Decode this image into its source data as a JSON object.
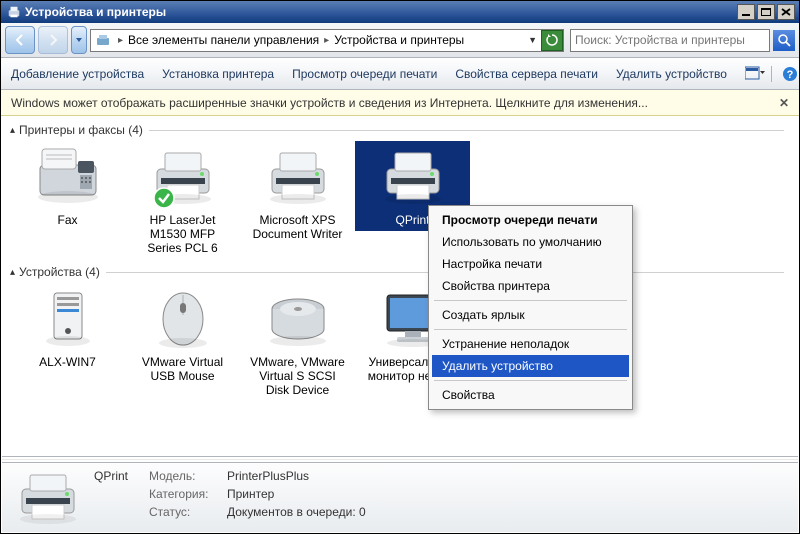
{
  "window": {
    "title": "Устройства и принтеры"
  },
  "nav": {
    "crumb1": "Все элементы панели управления",
    "crumb2": "Устройства и принтеры"
  },
  "search": {
    "placeholder": "Поиск: Устройства и принтеры"
  },
  "toolbar": {
    "add_device": "Добавление устройства",
    "add_printer": "Установка принтера",
    "view_queue": "Просмотр очереди печати",
    "server_props": "Свойства сервера печати",
    "delete_device": "Удалить устройство"
  },
  "infobar": {
    "text": "Windows может отображать расширенные значки устройств и сведения из Интернета.   Щелкните для изменения..."
  },
  "sections": {
    "printers": {
      "label": "Принтеры и факсы (4)"
    },
    "devices": {
      "label": "Устройства (4)"
    }
  },
  "printers": [
    {
      "label": "Fax"
    },
    {
      "label": "HP LaserJet M1530 MFP Series PCL 6"
    },
    {
      "label": "Microsoft XPS Document Writer"
    },
    {
      "label": "QPrint"
    }
  ],
  "devices": [
    {
      "label": "ALX-WIN7"
    },
    {
      "label": "VMware Virtual USB Mouse"
    },
    {
      "label": "VMware, VMware Virtual S SCSI Disk Device"
    },
    {
      "label": "Универсальный монитор не PnP"
    }
  ],
  "context_menu": {
    "open_queue": "Просмотр очереди печати",
    "set_default": "Использовать по умолчанию",
    "print_setup": "Настройка печати",
    "printer_props": "Свойства принтера",
    "create_shortcut": "Создать ярлык",
    "troubleshoot": "Устранение неполадок",
    "delete": "Удалить устройство",
    "properties": "Свойства"
  },
  "details": {
    "name": "QPrint",
    "model_label": "Модель:",
    "model_value": "PrinterPlusPlus",
    "category_label": "Категория:",
    "category_value": "Принтер",
    "status_label": "Статус:",
    "status_value": "Документов в очереди: 0"
  }
}
